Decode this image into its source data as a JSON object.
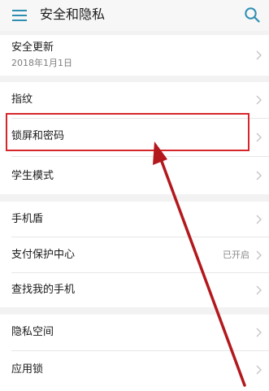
{
  "header": {
    "title": "安全和隐私",
    "menu_icon": "hamburger-menu-icon",
    "search_icon": "search-icon",
    "accent_color": "#2e8fb3"
  },
  "settings": {
    "security_update": {
      "label": "安全更新",
      "date": "2018年1月1日"
    },
    "fingerprint": {
      "label": "指纹"
    },
    "lock_screen_password": {
      "label": "锁屏和密码"
    },
    "student_mode": {
      "label": "学生模式"
    },
    "phone_shield": {
      "label": "手机盾"
    },
    "payment_protection": {
      "label": "支付保护中心",
      "status": "已开启"
    },
    "find_my_phone": {
      "label": "查找我的手机"
    },
    "private_space": {
      "label": "隐私空间"
    },
    "app_lock": {
      "label": "应用锁"
    }
  },
  "annotation": {
    "highlight_color": "#d7262b",
    "arrow_color": "#b3181d",
    "target": "锁屏和密码"
  }
}
